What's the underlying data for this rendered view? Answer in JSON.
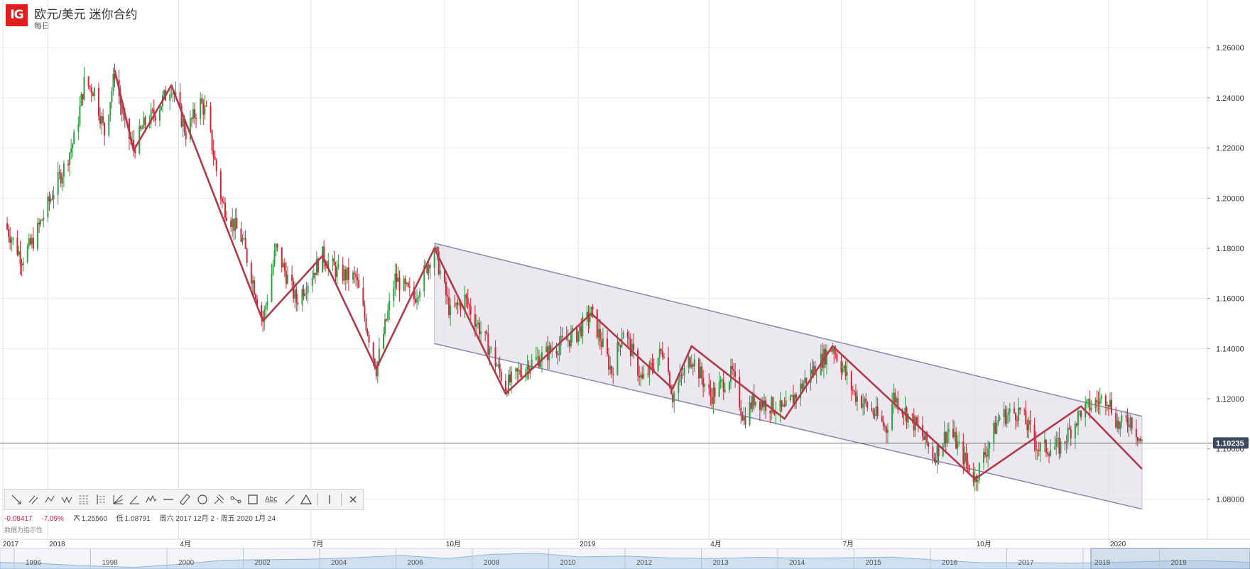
{
  "header": {
    "logo_text": "IG",
    "title": "欧元/美元 迷你合约",
    "interval": "每日"
  },
  "toolbar": {
    "tools": [
      "trend-line",
      "parallel-lines",
      "polyline",
      "zigzag",
      "fib-retracement",
      "fib-extension",
      "fib-fan",
      "angle",
      "pattern",
      "horizontal-line",
      "ruler",
      "circle",
      "pitchfork",
      "path",
      "rectangle",
      "text",
      "line",
      "triangle",
      "vertical-line",
      "close"
    ],
    "text_tool_label": "Abc"
  },
  "stats": {
    "change": "-0.08417",
    "change_pct": "-7.09%",
    "high_icon": "high-icon",
    "high": "1.25560",
    "low_label": "低",
    "low": "1.08791",
    "range": "周六 2017 12月 2 - 周五 2020 1月 24"
  },
  "source_note": "数据为指示性",
  "colors": {
    "up": "#2ea043",
    "down": "#d0263a",
    "zigzag": "#b23a48",
    "channel_fill": "#e4e0ea",
    "channel_line": "#8c86b0",
    "price_label_bg": "#3c4a5e"
  },
  "chart_data": {
    "type": "candlestick",
    "ylim": [
      1.064,
      1.279
    ],
    "y_ticks": [
      "1.26000",
      "1.24000",
      "1.22000",
      "1.20000",
      "1.18000",
      "1.16000",
      "1.14000",
      "1.12000",
      "1.10000",
      "1.08000"
    ],
    "y_tick_values": [
      1.26,
      1.24,
      1.22,
      1.2,
      1.18,
      1.16,
      1.14,
      1.12,
      1.1,
      1.08
    ],
    "current_price": 1.10235,
    "current_price_label": "1.10235",
    "x_range": [
      "2017-12-02",
      "2020-01-24"
    ],
    "x_labels": [
      {
        "label": "2017",
        "date": "2017-12-01"
      },
      {
        "label": "2018",
        "date": "2018-01-01"
      },
      {
        "label": "4月",
        "date": "2018-04-01"
      },
      {
        "label": "7月",
        "date": "2018-07-01"
      },
      {
        "label": "10月",
        "date": "2018-10-01"
      },
      {
        "label": "2019",
        "date": "2019-01-01"
      },
      {
        "label": "4月",
        "date": "2019-04-01"
      },
      {
        "label": "7月",
        "date": "2019-07-01"
      },
      {
        "label": "10月",
        "date": "2019-10-01"
      },
      {
        "label": "2020",
        "date": "2020-01-01"
      }
    ],
    "price_path": [
      [
        "2017-12-02",
        1.19
      ],
      [
        "2017-12-14",
        1.176
      ],
      [
        "2017-12-22",
        1.183
      ],
      [
        "2018-01-05",
        1.203
      ],
      [
        "2018-01-12",
        1.212
      ],
      [
        "2018-01-20",
        1.225
      ],
      [
        "2018-01-26",
        1.246
      ],
      [
        "2018-02-02",
        1.243
      ],
      [
        "2018-02-09",
        1.226
      ],
      [
        "2018-02-16",
        1.25
      ],
      [
        "2018-02-23",
        1.228
      ],
      [
        "2018-03-01",
        1.22
      ],
      [
        "2018-03-09",
        1.23
      ],
      [
        "2018-03-16",
        1.234
      ],
      [
        "2018-03-27",
        1.245
      ],
      [
        "2018-04-06",
        1.226
      ],
      [
        "2018-04-16",
        1.238
      ],
      [
        "2018-04-20",
        1.234
      ],
      [
        "2018-05-01",
        1.198
      ],
      [
        "2018-05-15",
        1.183
      ],
      [
        "2018-05-29",
        1.151
      ],
      [
        "2018-06-07",
        1.18
      ],
      [
        "2018-06-21",
        1.159
      ],
      [
        "2018-07-09",
        1.177
      ],
      [
        "2018-07-20",
        1.17
      ],
      [
        "2018-08-01",
        1.168
      ],
      [
        "2018-08-15",
        1.132
      ],
      [
        "2018-08-28",
        1.168
      ],
      [
        "2018-09-10",
        1.16
      ],
      [
        "2018-09-24",
        1.18
      ],
      [
        "2018-10-05",
        1.154
      ],
      [
        "2018-10-15",
        1.16
      ],
      [
        "2018-11-01",
        1.14
      ],
      [
        "2018-11-12",
        1.125
      ],
      [
        "2018-11-26",
        1.133
      ],
      [
        "2018-12-10",
        1.138
      ],
      [
        "2018-12-31",
        1.146
      ],
      [
        "2019-01-10",
        1.154
      ],
      [
        "2019-01-24",
        1.131
      ],
      [
        "2019-02-01",
        1.148
      ],
      [
        "2019-02-14",
        1.127
      ],
      [
        "2019-03-01",
        1.14
      ],
      [
        "2019-03-07",
        1.121
      ],
      [
        "2019-03-20",
        1.137
      ],
      [
        "2019-04-02",
        1.121
      ],
      [
        "2019-04-17",
        1.13
      ],
      [
        "2019-04-25",
        1.112
      ],
      [
        "2019-05-02",
        1.12
      ],
      [
        "2019-05-23",
        1.115
      ],
      [
        "2019-06-07",
        1.128
      ],
      [
        "2019-06-25",
        1.141
      ],
      [
        "2019-07-10",
        1.122
      ],
      [
        "2019-07-24",
        1.114
      ],
      [
        "2019-08-01",
        1.108
      ],
      [
        "2019-08-06",
        1.121
      ],
      [
        "2019-08-23",
        1.108
      ],
      [
        "2019-09-03",
        1.097
      ],
      [
        "2019-09-13",
        1.108
      ],
      [
        "2019-10-01",
        1.088
      ],
      [
        "2019-10-18",
        1.113
      ],
      [
        "2019-11-01",
        1.115
      ],
      [
        "2019-11-14",
        1.1
      ],
      [
        "2019-11-29",
        1.101
      ],
      [
        "2019-12-13",
        1.115
      ],
      [
        "2019-12-31",
        1.121
      ],
      [
        "2020-01-08",
        1.109
      ],
      [
        "2020-01-16",
        1.112
      ],
      [
        "2020-01-24",
        1.102
      ]
    ],
    "zigzag": [
      [
        "2018-02-16",
        1.251
      ],
      [
        "2018-03-01",
        1.219
      ],
      [
        "2018-03-27",
        1.245
      ],
      [
        "2018-05-29",
        1.151
      ],
      [
        "2018-07-09",
        1.177
      ],
      [
        "2018-08-15",
        1.132
      ],
      [
        "2018-09-24",
        1.18
      ],
      [
        "2018-11-12",
        1.122
      ],
      [
        "2019-01-10",
        1.154
      ],
      [
        "2019-03-07",
        1.124
      ],
      [
        "2019-03-20",
        1.141
      ],
      [
        "2019-05-23",
        1.112
      ],
      [
        "2019-06-25",
        1.141
      ],
      [
        "2019-10-01",
        1.088
      ],
      [
        "2019-12-13",
        1.117
      ],
      [
        "2020-01-24",
        1.092
      ]
    ],
    "channel": {
      "upper": [
        [
          "2018-09-24",
          1.182
        ],
        [
          "2020-01-24",
          1.113
        ]
      ],
      "lower": [
        [
          "2018-09-24",
          1.142
        ],
        [
          "2020-01-24",
          1.076
        ]
      ]
    },
    "navigator_labels": [
      "1996",
      "1998",
      "2000",
      "2002",
      "2004",
      "2006",
      "2008",
      "2010",
      "2012",
      "2013",
      "2014",
      "2015",
      "2016",
      "2017",
      "2018",
      "2019"
    ],
    "navigator_values": [
      1.12,
      1.05,
      0.95,
      0.88,
      1.02,
      1.22,
      1.25,
      1.27,
      1.35,
      1.45,
      1.3,
      1.5,
      1.55,
      1.38,
      1.42,
      1.33,
      1.3,
      1.36,
      1.32,
      1.34,
      1.37,
      1.22,
      1.1,
      1.1,
      1.08,
      1.12,
      1.18,
      1.2,
      1.12
    ]
  }
}
